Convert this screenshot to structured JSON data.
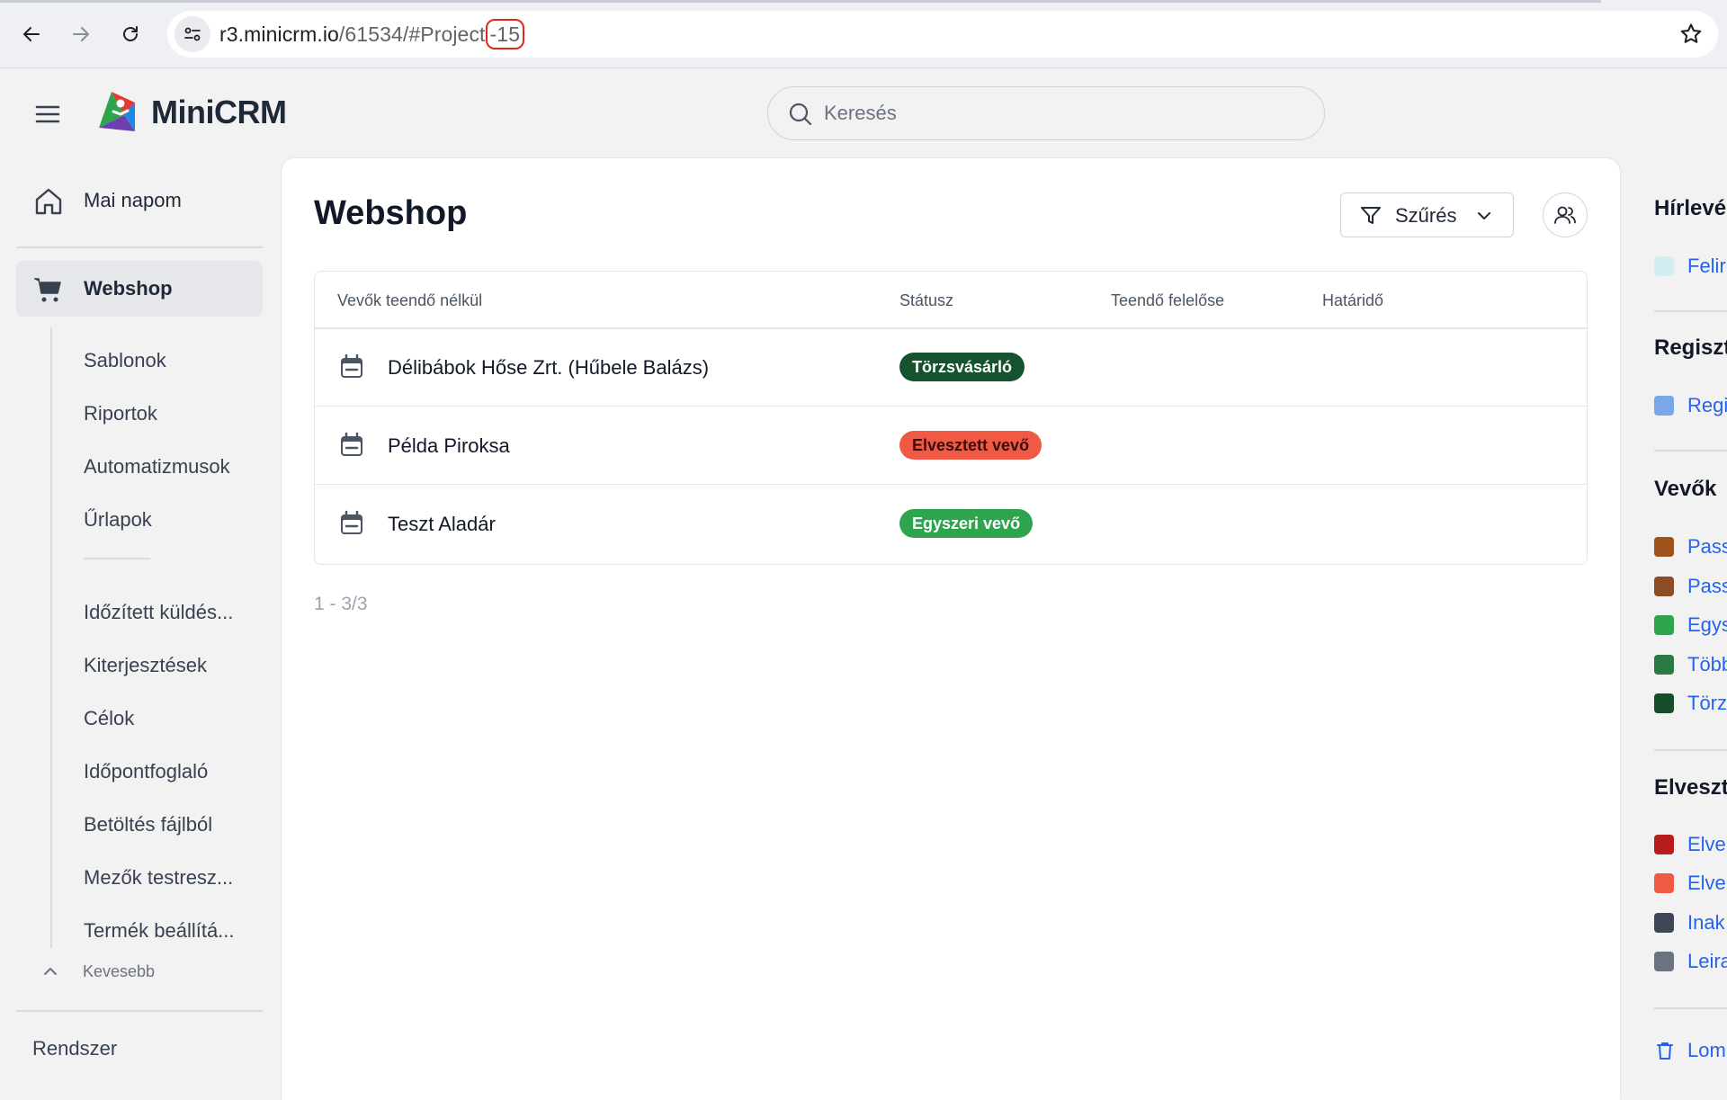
{
  "browser": {
    "url_host": "r3.minicrm.io",
    "url_path": "/61534/#Project",
    "url_highlight": "-15"
  },
  "header": {
    "logo": "MiniCRM",
    "search_placeholder": "Keresés"
  },
  "sidebar": {
    "home": "Mai napom",
    "active": "Webshop",
    "sub_items_top": [
      "Sablonok",
      "Riportok",
      "Automatizmusok",
      "Űrlapok"
    ],
    "sub_items_bottom": [
      "Időzített küldés...",
      "Kiterjesztések",
      "Célok",
      "Időpontfoglaló",
      "Betöltés fájlból",
      "Mezők testresz...",
      "Termék beállítá..."
    ],
    "less": "Kevesebb",
    "system": "Rendszer"
  },
  "main": {
    "title": "Webshop",
    "filter_label": "Szűrés",
    "columns": [
      "Vevők teendő nélkül",
      "Státusz",
      "Teendő felelőse",
      "Határidő"
    ],
    "rows": [
      {
        "name": "Délibábok Hőse Zrt. (Hűbele Balázs)",
        "status": "Törzsvásárló",
        "status_color": "#14532d",
        "status_text_color": "#ffffff"
      },
      {
        "name": "Példa Piroksa",
        "status": "Elvesztett vevő",
        "status_color": "#f05a45",
        "status_text_color": "#3b0d0a"
      },
      {
        "name": "Teszt Aladár",
        "status": "Egyszeri vevő",
        "status_color": "#2ea44f",
        "status_text_color": "#ffffff"
      }
    ],
    "pager": "1 - 3/3"
  },
  "right_panel": {
    "groups": [
      {
        "title": "Hírlevé",
        "items": [
          {
            "label": "Felir",
            "color": "#d3eef3"
          }
        ]
      },
      {
        "title": "Regiszt",
        "items": [
          {
            "label": "Regi",
            "color": "#7aa7e8"
          }
        ]
      },
      {
        "title": "Vevők",
        "items": [
          {
            "label": "Pass",
            "color": "#a0521d"
          },
          {
            "label": "Pass",
            "color": "#8b4d24"
          },
          {
            "label": "Egys",
            "color": "#2ea44f"
          },
          {
            "label": "Több",
            "color": "#2a7a45"
          },
          {
            "label": "Törz",
            "color": "#174d2a"
          }
        ]
      },
      {
        "title": "Elveszt",
        "items": [
          {
            "label": "Elve",
            "color": "#b91c1c"
          },
          {
            "label": "Elve",
            "color": "#f05a45"
          },
          {
            "label": "Inak",
            "color": "#3f4756"
          },
          {
            "label": "Leira",
            "color": "#6b7280"
          }
        ]
      }
    ],
    "trash": "Lom"
  }
}
